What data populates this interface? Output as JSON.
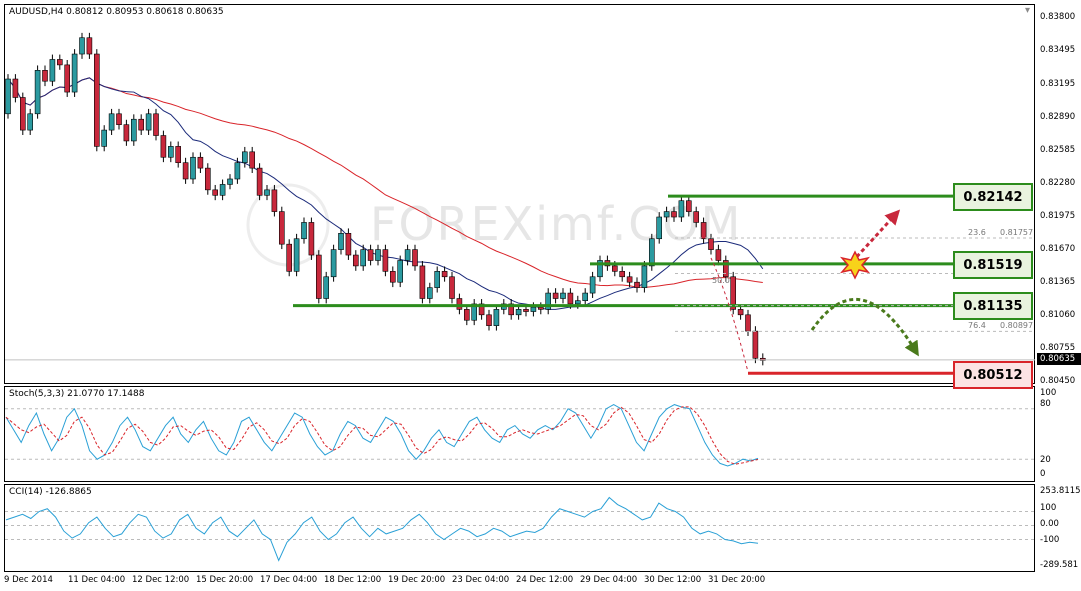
{
  "header": {
    "symbol_info": "AUDUSD,H4  0.80812 0.80953 0.80618 0.80635"
  },
  "watermark": "FOREXimf.COM",
  "price_axis": [
    "0.83800",
    "0.83495",
    "0.83195",
    "0.82890",
    "0.82585",
    "0.82280",
    "0.81975",
    "0.81670",
    "0.81365",
    "0.81060",
    "0.80755",
    "0.80450"
  ],
  "current_price": "0.80635",
  "levels": {
    "resistance_1": "0.82142",
    "resistance_2": "0.81519",
    "support_1": "0.81135",
    "target": "0.80512"
  },
  "fib_labels": {
    "fib_23": "23.6",
    "fib_23_price": "0.81757",
    "fib_76": "76.4",
    "fib_76_price": "0.80897",
    "fib_50": "50.0"
  },
  "stoch": {
    "title": "Stoch(5,3,3) 21.0770 17.1488",
    "axis": [
      "100",
      "80",
      "20",
      "0"
    ]
  },
  "cci": {
    "title": "CCI(14) -126.8865",
    "axis": [
      "253.8115",
      "100",
      "0.00",
      "-100",
      "-289.581"
    ]
  },
  "time_axis": [
    "9 Dec 2014",
    "11 Dec 04:00",
    "12 Dec 12:00",
    "15 Dec 20:00",
    "17 Dec 04:00",
    "18 Dec 12:00",
    "19 Dec 20:00",
    "23 Dec 04:00",
    "24 Dec 12:00",
    "29 Dec 04:00",
    "30 Dec 12:00",
    "31 Dec 20:00"
  ],
  "colors": {
    "bull_candle": "#2b9aa0",
    "bear_candle": "#c8283c",
    "ma_slow": "#d9242a",
    "ma_fast": "#1b2a7a",
    "level_green": "#2c8c1c",
    "level_red": "#d9242a",
    "stoch_main": "#2aa0d6",
    "stoch_signal": "#d9242a",
    "cci_line": "#2aa0d6"
  }
}
